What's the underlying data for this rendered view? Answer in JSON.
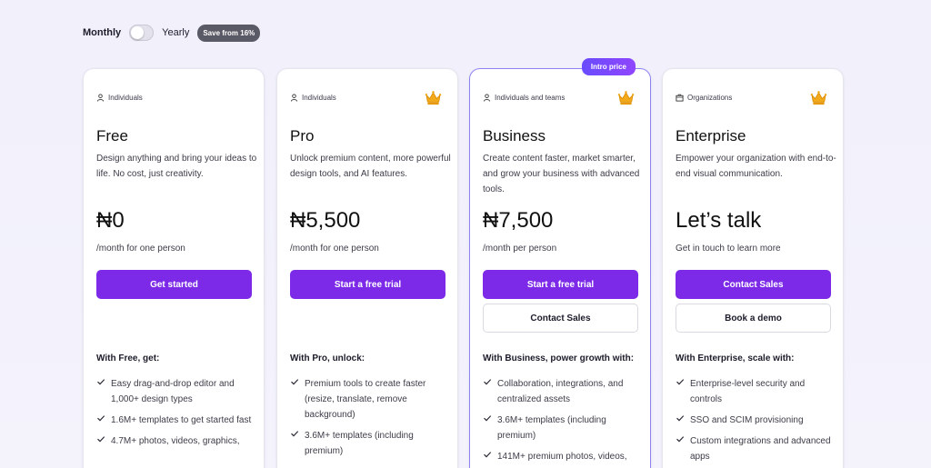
{
  "billing": {
    "monthly_label": "Monthly",
    "yearly_label": "Yearly",
    "save_badge": "Save from 16%"
  },
  "plans": [
    {
      "audience": "Individuals",
      "name": "Free",
      "description": "Design anything and bring your ideas to life. No cost, just creativity.",
      "price": "₦0",
      "period": "/month for one person",
      "primary_cta": "Get started",
      "features_heading": "With Free, get:",
      "features": [
        "Easy drag-and-drop editor and 1,000+ design types",
        "1.6M+ templates to get started fast",
        "4.7M+ photos, videos, graphics,"
      ]
    },
    {
      "audience": "Individuals",
      "name": "Pro",
      "description": "Unlock premium content, more powerful design tools, and AI features.",
      "price": "₦5,500",
      "period": "/month for one person",
      "primary_cta": "Start a free trial",
      "features_heading": "With Pro, unlock:",
      "features": [
        "Premium tools to create faster (resize, translate, remove background)",
        "3.6M+ templates (including premium)"
      ]
    },
    {
      "badge": "Intro price",
      "audience": "Individuals and teams",
      "name": "Business",
      "description": "Create content faster, market smarter, and grow your business with advanced tools.",
      "price": "₦7,500",
      "period": "/month per person",
      "primary_cta": "Start a free trial",
      "secondary_cta": "Contact Sales",
      "features_heading": "With Business, power growth with:",
      "features": [
        "Collaboration, integrations, and centralized assets",
        "3.6M+ templates (including premium)",
        "141M+ premium photos, videos,"
      ]
    },
    {
      "audience": "Organizations",
      "name": "Enterprise",
      "description": "Empower your organization with end-to-end visual communication.",
      "price": "Let’s talk",
      "period": "Get in touch to learn more",
      "primary_cta": "Contact Sales",
      "secondary_cta": "Book a demo",
      "features_heading": "With Enterprise, scale with:",
      "features": [
        "Enterprise-level security and controls",
        "SSO and SCIM provisioning",
        "Custom integrations and advanced apps"
      ]
    }
  ],
  "colors": {
    "primary": "#7d2ae8",
    "badge_gradient_start": "#6a4cff",
    "featured_border": "#8d84f3",
    "crown": "#f2a91a"
  },
  "icons": {
    "person": "person-icon",
    "organization": "building-icon",
    "crown": "crown-icon",
    "check": "check-icon"
  }
}
